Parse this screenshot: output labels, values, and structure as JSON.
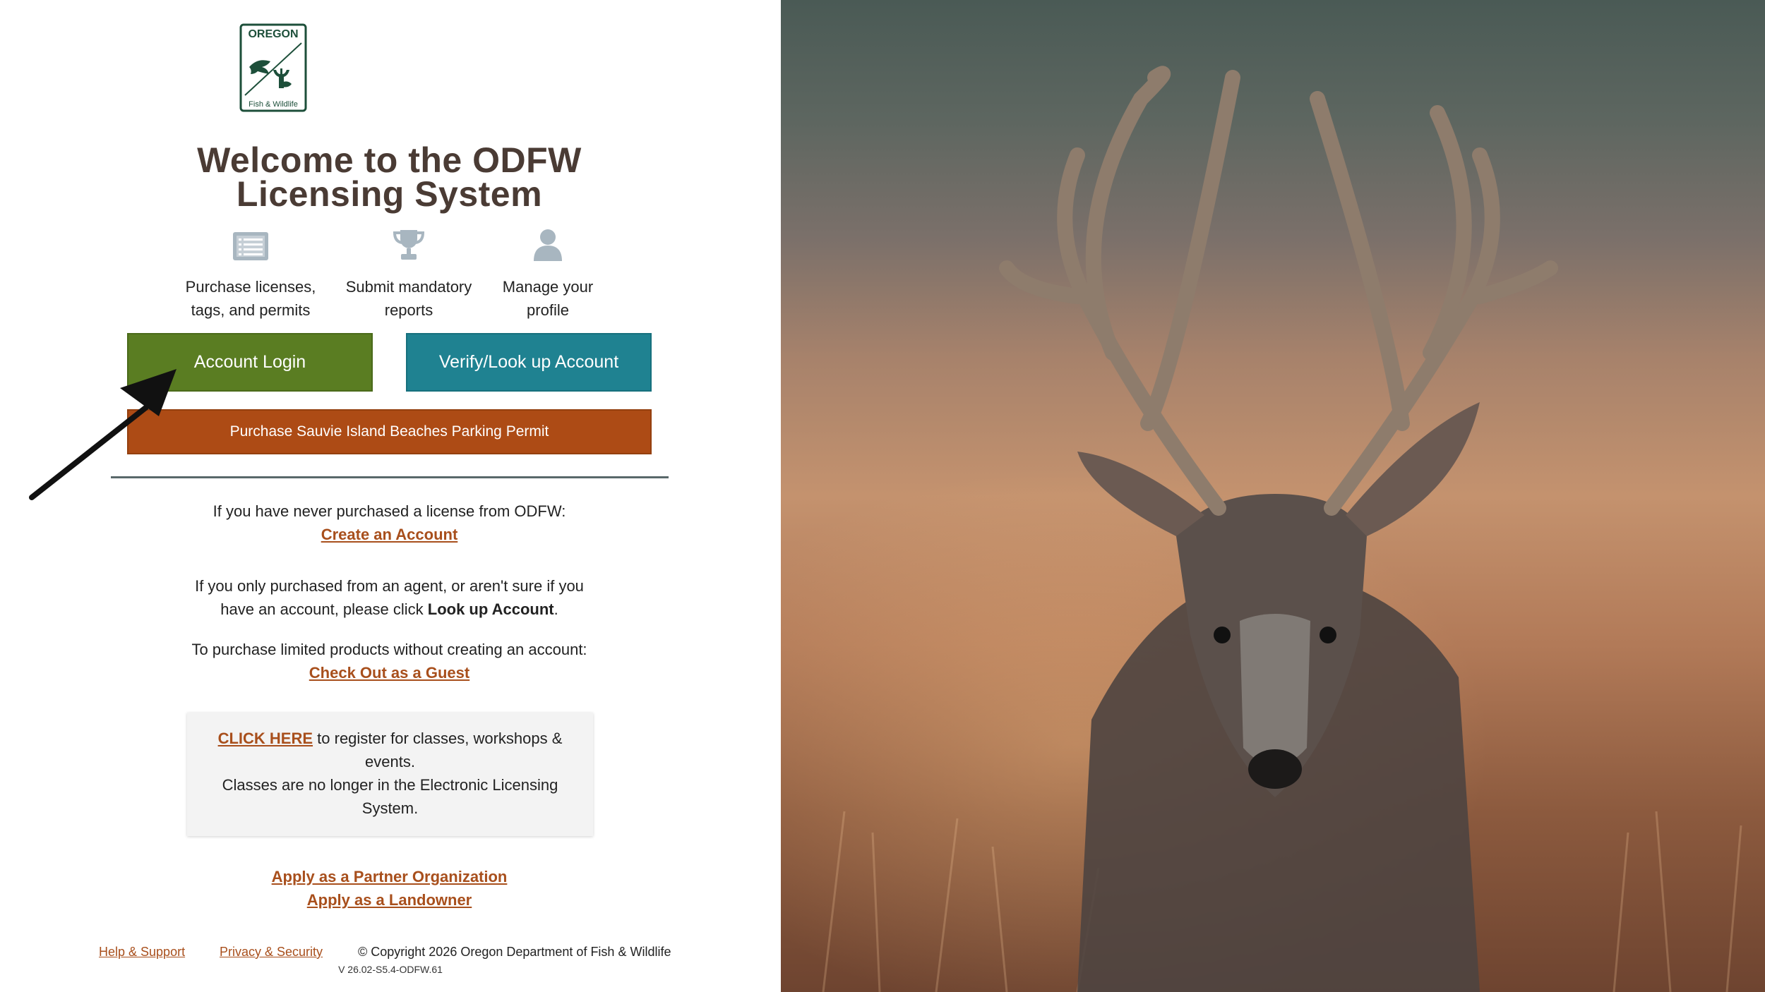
{
  "logo": {
    "top_text": "OREGON",
    "bottom_text": "Fish & Wildlife"
  },
  "welcome": {
    "line1": "Welcome to the ODFW",
    "line2": "Licensing System"
  },
  "features": [
    {
      "icon": "list-icon",
      "line1": "Purchase licenses,",
      "line2": "tags, and permits"
    },
    {
      "icon": "trophy-icon",
      "line1": "Submit mandatory",
      "line2": "reports"
    },
    {
      "icon": "user-icon",
      "line1": "Manage your",
      "line2": "profile"
    }
  ],
  "buttons": {
    "login": "Account Login",
    "verify": "Verify/Look up Account",
    "parking": "Purchase Sauvie Island Beaches Parking Permit"
  },
  "info": {
    "never_purchased": "If you have never purchased a license from ODFW:",
    "create_account": "Create an Account",
    "agent_line1": "If you only purchased from an agent, or aren't sure if you",
    "agent_line2_start": "have an account, please click ",
    "agent_line2_bold": "Look up Account",
    "agent_line2_end": ".",
    "guest_intro": "To purchase limited products without creating an account:",
    "guest_link": "Check Out as a Guest"
  },
  "classes_box": {
    "link": "CLICK HERE",
    "text1": " to register for classes, workshops &",
    "text2": "events.",
    "text3": "Classes are no longer in the Electronic Licensing",
    "text4": "System."
  },
  "apply": {
    "partner": "Apply as a Partner Organization",
    "landowner": "Apply as a Landowner"
  },
  "footer": {
    "help": "Help & Support",
    "privacy": "Privacy & Security",
    "copyright": "© Copyright 2026 Oregon Department of Fish & Wildlife",
    "version": "V 26.02-S5.4-ODFW.61"
  },
  "colors": {
    "login_green": "#5a7d22",
    "verify_teal": "#1f8291",
    "parking_orange": "#ad4b15",
    "link_brown": "#a84f1c",
    "title_brown": "#4a3b34",
    "logo_green": "#1d4f3a"
  }
}
